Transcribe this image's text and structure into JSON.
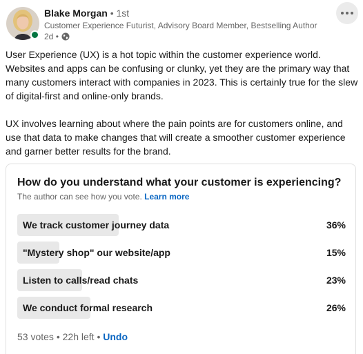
{
  "author": {
    "name": "Blake Morgan",
    "degree": "1st",
    "headline": "Customer Experience Futurist, Advisory Board Member, Bestselling Author",
    "time": "2d"
  },
  "post": {
    "paragraphs": [
      "User Experience (UX) is a hot topic within the customer experience world. Websites and apps can be confusing or clunky, yet they are the primary way that many customers interact with companies in 2023. This is certainly true for the slew of digital-first and online-only brands.",
      "UX involves learning about where the pain points are for customers online, and use that data to make changes that will create a smoother customer experience and garner better results for the brand."
    ]
  },
  "poll": {
    "question": "How do you understand what your customer is experiencing?",
    "visibility_text": "The author can see how you vote.",
    "learn_more": "Learn more",
    "options": [
      {
        "label": "We track customer journey data",
        "percent": "36%",
        "share": 0.36
      },
      {
        "label": "\"Mystery shop\" our website/app",
        "percent": "15%",
        "share": 0.15
      },
      {
        "label": "Listen to calls/read chats",
        "percent": "23%",
        "share": 0.23
      },
      {
        "label": "We conduct formal research",
        "percent": "26%",
        "share": 0.26
      }
    ],
    "votes": "53 votes",
    "time_left": "22h left",
    "undo": "Undo"
  },
  "icons": {
    "more": "more-horizontal-icon",
    "visibility": "globe-icon"
  },
  "colors": {
    "link": "#0a66c2",
    "presence": "#057642",
    "bar": "#e8e8e8"
  }
}
